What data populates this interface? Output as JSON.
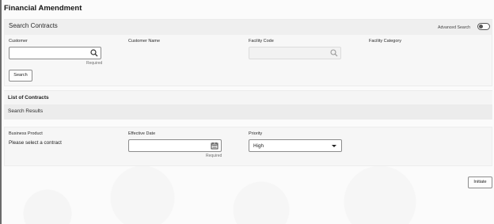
{
  "page": {
    "title": "Financial Amendment"
  },
  "search_panel": {
    "title": "Search Contracts",
    "advanced_search_label": "Advanced Search",
    "advanced_search_on": false,
    "fields": {
      "customer": {
        "label": "Customer",
        "value": "",
        "hint": "Required"
      },
      "customer_name": {
        "label": "Customer Name"
      },
      "facility_code": {
        "label": "Facility Code",
        "value": ""
      },
      "facility_category": {
        "label": "Facility Category"
      }
    },
    "search_button": "Search"
  },
  "list": {
    "title": "List of Contracts",
    "results_title": "Search Results"
  },
  "details": {
    "business_product": {
      "label": "Business Product",
      "value": "Please select a contract"
    },
    "effective_date": {
      "label": "Effective Date",
      "value": "",
      "hint": "Required"
    },
    "priority": {
      "label": "Priority",
      "value": "High"
    }
  },
  "footer": {
    "initiate_button": "Initiate"
  },
  "icons": {
    "search": "search-icon",
    "calendar": "calendar-icon",
    "dropdown": "chevron-down-icon",
    "toggle": "toggle-icon"
  }
}
